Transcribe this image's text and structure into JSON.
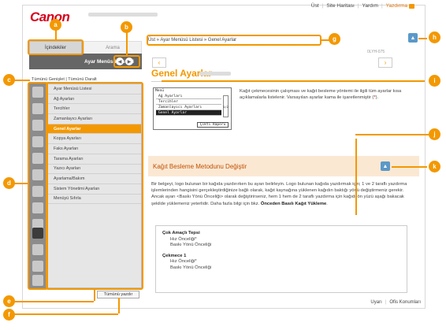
{
  "header": {
    "logo": "Canon",
    "links": [
      "Üst",
      "Site Haritası",
      "Yardım"
    ],
    "print": "Yazdırma"
  },
  "left": {
    "tabs": {
      "contents": "İçindekiler",
      "search": "Arama"
    },
    "title": "Ayar Menüsü Listesi",
    "expand": "Tümünü Genişlet | Tümünü Daralt",
    "menu": [
      "Ayar Menüsü Listesi",
      "Ağ Ayarları",
      "Tercihler",
      "Zamanlayıcı Ayarları",
      "Genel Ayarlar",
      "Kopya Ayarları",
      "Faks Ayarları",
      "Tarama Ayarları",
      "Yazıcı Ayarları",
      "Ayarlama/Bakım",
      "Sistem Yönetimi Ayarları",
      "Menüyü Sıfırla"
    ],
    "active_index": 4,
    "print_all": "Tümünü yazdır"
  },
  "main": {
    "breadcrumb": "Üst » Ayar Menüsü Listesi » Genel Ayarlar",
    "topic_id": "0LYH-075",
    "title": "Genel Ayarlar",
    "screen": {
      "header": "Menü",
      "lines": [
        "Ağ Ayarları",
        "Tercihler",
        "Zamanlayıcı Ayarları",
        "Genel Ayarlar"
      ],
      "selected": 3,
      "scroll": "1/2",
      "button": "Çıktı Raporu"
    },
    "intro": "Kağıt çekmecesinin çalışması ve kağıt besleme yöntemi ile ilgili tüm ayarlar kısa açıklamalarla listelenir. Varsayılan ayarlar kama ile işaretlenmiştir (",
    "intro_star": "*",
    "intro_end": ").",
    "section_title": "Kağıt Besleme Metodunu Değiştir",
    "body_1": "Bir belgeyi, logo bulunan bir kağıda yazdırırken bu ayarı belirleyin. Logo bulunan kağıda yazdırmak için; 1 ve 2 taraflı yazdırma işlemlerinden hangisini gerçekleştirdiğinize bağlı olarak, kağıt kaynağına yüklenen kağıdın baktığı yönü değiştirmeniz gerekir. Ancak ayarı <Baskı Yönü Önceliği> olarak değiştirirseniz, hem 1 hem de 2 taraflı yazdırma için kağıdı ön yüzü aşağı bakacak şekilde yüklemeniz yeterlidir. Daha fazla bilgi için bkz. ",
    "body_link": "Önceden Basılı Kağıt Yükleme",
    "body_2": ".",
    "groups": [
      {
        "title": "Çok Amaçlı Tepsi",
        "items": [
          "Hız Önceliği*",
          "Baskı Yönü Önceliği"
        ]
      },
      {
        "title": "Çekmece 1",
        "items": [
          "Hız Önceliği*",
          "Baskı Yönü Önceliği"
        ]
      }
    ]
  },
  "footer": {
    "links": [
      "Uyarı",
      "Ofis Konumları"
    ]
  },
  "callouts": [
    "a",
    "b",
    "c",
    "d",
    "e",
    "f",
    "g",
    "h",
    "i",
    "j",
    "k"
  ],
  "colors": {
    "accent": "#f39800",
    "brand": "#d6001c",
    "nav_dark": "#666666",
    "blue_icon": "#5a99c9"
  }
}
